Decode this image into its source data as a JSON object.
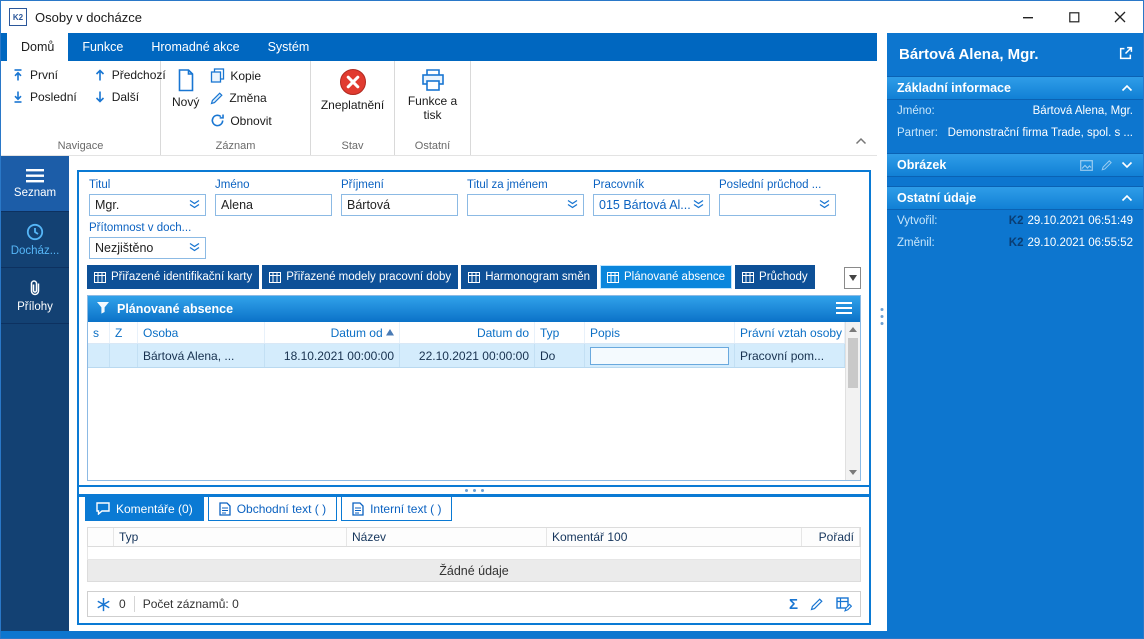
{
  "window": {
    "title": "Osoby v docházce",
    "app_badge": "K2"
  },
  "ribbon": {
    "tabs": [
      {
        "label": "Domů",
        "active": true
      },
      {
        "label": "Funkce",
        "active": false
      },
      {
        "label": "Hromadné akce",
        "active": false
      },
      {
        "label": "Systém",
        "active": false
      }
    ],
    "nav_group": {
      "label": "Navigace",
      "items": [
        {
          "label": "První"
        },
        {
          "label": "Poslední"
        },
        {
          "label": "Předchozí"
        },
        {
          "label": "Další"
        }
      ]
    },
    "record_group": {
      "label": "Záznam",
      "new_label": "Nový",
      "items": [
        {
          "label": "Kopie"
        },
        {
          "label": "Změna"
        },
        {
          "label": "Obnovit"
        }
      ]
    },
    "state_group": {
      "label": "Stav",
      "invalidate_label": "Zneplatnění"
    },
    "other_group": {
      "label": "Ostatní",
      "print_label": "Funkce a tisk"
    }
  },
  "sidebar": {
    "items": [
      {
        "label": "Seznam"
      },
      {
        "label": "Docház..."
      },
      {
        "label": "Přílohy"
      }
    ]
  },
  "form": {
    "fields": [
      {
        "label": "Titul",
        "value": "Mgr."
      },
      {
        "label": "Jméno",
        "value": "Alena"
      },
      {
        "label": "Příjmení",
        "value": "Bártová"
      },
      {
        "label": "Titul za jménem",
        "value": ""
      },
      {
        "label": "Pracovník",
        "value": "015 Bártová Al..."
      },
      {
        "label": "Poslední průchod ...",
        "value": ""
      }
    ],
    "presence": {
      "label": "Přítomnost v doch...",
      "value": "Nezjištěno"
    }
  },
  "detail_tabs": {
    "items": [
      {
        "label": "Přiřazené identifikační karty"
      },
      {
        "label": "Přiřazené modely pracovní doby"
      },
      {
        "label": "Harmonogram směn"
      },
      {
        "label": "Plánované absence"
      },
      {
        "label": "Průchody"
      }
    ]
  },
  "grid": {
    "title": "Plánované absence",
    "columns": [
      {
        "label": "s"
      },
      {
        "label": "Z"
      },
      {
        "label": "Osoba"
      },
      {
        "label": "Datum od"
      },
      {
        "label": "Datum do"
      },
      {
        "label": "Typ"
      },
      {
        "label": "Popis"
      },
      {
        "label": "Právní vztah osoby"
      }
    ],
    "sort_column": "Datum od",
    "row": {
      "osoba": "Bártová Alena, ...",
      "datum_od": "18.10.2021 00:00:00",
      "datum_do": "22.10.2021 00:00:00",
      "typ": "Do",
      "popis": "",
      "pravni_vztah": "Pracovní pom..."
    }
  },
  "bottom_tabs": {
    "items": [
      {
        "label": "Komentáře (0)",
        "active": true
      },
      {
        "label": "Obchodní text ( )",
        "active": false
      },
      {
        "label": "Interní text ( )",
        "active": false
      }
    ]
  },
  "comments": {
    "columns": [
      {
        "label": "Typ"
      },
      {
        "label": "Název"
      },
      {
        "label": "Komentář 100"
      },
      {
        "label": "Pořadí"
      }
    ],
    "empty_text": "Žádné údaje"
  },
  "status": {
    "badge": "0",
    "records": "Počet záznamů: 0",
    "sum_icon": "Σ"
  },
  "right_panel": {
    "title": "Bártová Alena, Mgr.",
    "basic": {
      "title": "Základní informace",
      "rows": [
        {
          "label": "Jméno:",
          "value": "Bártová Alena, Mgr."
        },
        {
          "label": "Partner:",
          "value": "Demonstrační firma Trade, spol. s ..."
        }
      ]
    },
    "image": {
      "title": "Obrázek"
    },
    "other": {
      "title": "Ostatní údaje",
      "rows": [
        {
          "label": "Vytvořil:",
          "user": "K2",
          "value": "29.10.2021 06:51:49"
        },
        {
          "label": "Změnil:",
          "user": "K2",
          "value": "29.10.2021 06:55:52"
        }
      ]
    }
  },
  "colors": {
    "ribbon_blue": "#0067c0",
    "accent_blue": "#0a7ad4",
    "panel_blue": "#0d76cf",
    "detail_tab_blue": "#0d5097",
    "active_tab_blue": "#0a86dc",
    "row_highlight": "#d4ecfc",
    "invalid_red": "#e13b30",
    "sidebar_blue": "#134173"
  }
}
